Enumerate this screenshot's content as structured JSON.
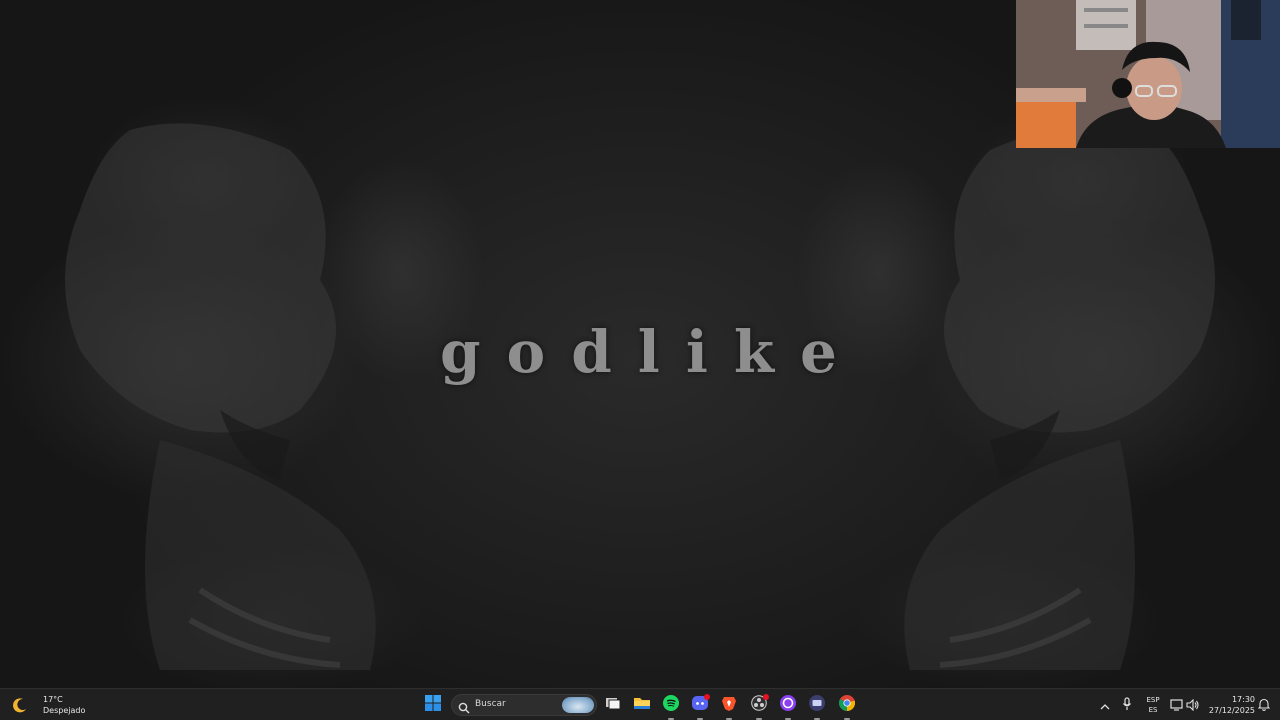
{
  "wallpaper": {
    "title": "godlike"
  },
  "taskbar": {
    "weather": {
      "temperature": "17°C",
      "condition": "Despejado",
      "icon": "moon-icon"
    },
    "start": {
      "icon": "windows-start-icon"
    },
    "search": {
      "placeholder": "Buscar",
      "icon": "search-icon"
    },
    "pinned_apps": [
      {
        "name": "task-view",
        "icon": "task-view-icon"
      },
      {
        "name": "file-explorer",
        "icon": "folder-icon"
      },
      {
        "name": "spotify",
        "icon": "spotify-icon"
      },
      {
        "name": "discord",
        "icon": "discord-icon"
      },
      {
        "name": "brave",
        "icon": "brave-icon"
      },
      {
        "name": "obs",
        "icon": "obs-icon"
      },
      {
        "name": "app-circle",
        "icon": "circle-app-icon"
      },
      {
        "name": "app-monitor",
        "icon": "monitor-app-icon"
      },
      {
        "name": "chrome",
        "icon": "chrome-icon"
      }
    ],
    "tray": {
      "language_line1": "ESP",
      "language_line2": "ES",
      "time": "17:30",
      "date": "27/12/2025"
    }
  },
  "colors": {
    "taskbar_bg": "#202020",
    "accent_windows": "#2d8fe6",
    "spotify": "#1ed760",
    "discord": "#5865f2",
    "brave": "#fb542b",
    "chrome_red": "#db4437"
  }
}
